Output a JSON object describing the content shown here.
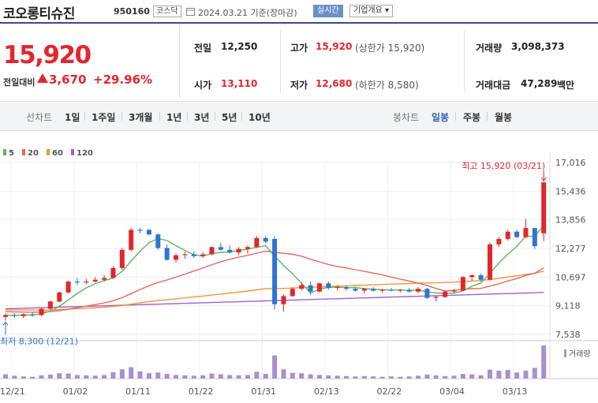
{
  "header": {
    "name": "코오롱티슈진",
    "code": "950160",
    "market": "코스닥",
    "asof": "2024.03.21  기준(장마감)",
    "realtime_label": "실시간",
    "overview_label": "기업개요 ▾"
  },
  "price": {
    "current": "15,920",
    "change_label": "전일대비",
    "change": "3,670",
    "change_pct": "+29.96%"
  },
  "stats": {
    "prev_close_label": "전일",
    "prev_close": "12,250",
    "open_label": "시가",
    "open": "13,110",
    "high_label": "고가",
    "high": "15,920",
    "high_note": "(상한가 15,920)",
    "low_label": "저가",
    "low": "12,680",
    "low_note": "(하한가 8,580)",
    "volume_label": "거래량",
    "volume": "3,098,373",
    "amount_label": "거래대금",
    "amount": "47,289",
    "amount_unit": "백만"
  },
  "period_bar": {
    "line_label": "선차트",
    "line_periods": [
      "1일",
      "1주일",
      "3개월",
      "1년",
      "3년",
      "5년",
      "10년"
    ],
    "candle_label": "봉차트",
    "candle_periods": [
      "일봉",
      "주봉",
      "월봉"
    ],
    "active_candle": "일봉"
  },
  "colors": {
    "up": "#e3262d",
    "down": "#2f74d0",
    "ma5": "#5cb85c",
    "ma20": "#e8685f",
    "ma60": "#f0963a",
    "ma120": "#a064cc"
  },
  "chart_data": {
    "type": "candlestick",
    "legend": [
      {
        "name": "5",
        "color": "#5cb85c"
      },
      {
        "name": "20",
        "color": "#e8685f"
      },
      {
        "name": "60",
        "color": "#f0963a"
      },
      {
        "name": "120",
        "color": "#a064cc"
      }
    ],
    "y_ticks": [
      "17,016",
      "15,436",
      "13,856",
      "12,277",
      "10,697",
      "9,118",
      "7,538"
    ],
    "ylim": [
      7538,
      17016
    ],
    "x_tick_labels": [
      "12/21",
      "01/02",
      "01/11",
      "01/22",
      "01/31",
      "02/13",
      "02/22",
      "03/04",
      "03/13"
    ],
    "x_tick_index": [
      0,
      7,
      14,
      21,
      28,
      35,
      42,
      49,
      56
    ],
    "max_annotation": "최고 15,920 (03/21)",
    "min_annotation": "최저 8,300 (12/21)",
    "volume_label": "거래량",
    "candles": [
      {
        "o": 8500,
        "h": 8700,
        "l": 8300,
        "c": 8600
      },
      {
        "o": 8600,
        "h": 8700,
        "l": 8450,
        "c": 8550
      },
      {
        "o": 8550,
        "h": 8700,
        "l": 8450,
        "c": 8650
      },
      {
        "o": 8650,
        "h": 8750,
        "l": 8500,
        "c": 8600
      },
      {
        "o": 8600,
        "h": 9000,
        "l": 8550,
        "c": 8950
      },
      {
        "o": 8950,
        "h": 9400,
        "l": 8900,
        "c": 9350
      },
      {
        "o": 9350,
        "h": 9900,
        "l": 9300,
        "c": 9850
      },
      {
        "o": 9850,
        "h": 10500,
        "l": 9800,
        "c": 10450
      },
      {
        "o": 10450,
        "h": 10650,
        "l": 10250,
        "c": 10400
      },
      {
        "o": 10400,
        "h": 10600,
        "l": 10300,
        "c": 10450
      },
      {
        "o": 10450,
        "h": 10700,
        "l": 10400,
        "c": 10550
      },
      {
        "o": 10550,
        "h": 10800,
        "l": 10450,
        "c": 10650
      },
      {
        "o": 10650,
        "h": 11300,
        "l": 10600,
        "c": 11200
      },
      {
        "o": 11200,
        "h": 12300,
        "l": 11100,
        "c": 12200
      },
      {
        "o": 12200,
        "h": 13400,
        "l": 12100,
        "c": 13300
      },
      {
        "o": 13300,
        "h": 13400,
        "l": 13100,
        "c": 13250
      },
      {
        "o": 13300,
        "h": 13350,
        "l": 13000,
        "c": 13050
      },
      {
        "o": 13050,
        "h": 13100,
        "l": 12200,
        "c": 12300
      },
      {
        "o": 12300,
        "h": 12500,
        "l": 11600,
        "c": 11650
      },
      {
        "o": 11650,
        "h": 12000,
        "l": 11500,
        "c": 11900
      },
      {
        "o": 11900,
        "h": 12100,
        "l": 11700,
        "c": 11950
      },
      {
        "o": 11950,
        "h": 12100,
        "l": 11750,
        "c": 11850
      },
      {
        "o": 11850,
        "h": 12050,
        "l": 11750,
        "c": 11950
      },
      {
        "o": 11950,
        "h": 12400,
        "l": 11900,
        "c": 12350
      },
      {
        "o": 12350,
        "h": 12600,
        "l": 12150,
        "c": 12200
      },
      {
        "o": 12200,
        "h": 12450,
        "l": 12000,
        "c": 12050
      },
      {
        "o": 12050,
        "h": 12350,
        "l": 11900,
        "c": 12250
      },
      {
        "o": 12250,
        "h": 12450,
        "l": 12000,
        "c": 12350
      },
      {
        "o": 12350,
        "h": 12950,
        "l": 12300,
        "c": 12850
      },
      {
        "o": 12850,
        "h": 12950,
        "l": 12550,
        "c": 12650
      },
      {
        "o": 12800,
        "h": 12950,
        "l": 8900,
        "c": 9200
      },
      {
        "o": 9200,
        "h": 9750,
        "l": 8800,
        "c": 9650
      },
      {
        "o": 9650,
        "h": 10150,
        "l": 9600,
        "c": 10050
      },
      {
        "o": 10050,
        "h": 10400,
        "l": 9950,
        "c": 10250
      },
      {
        "o": 10250,
        "h": 10450,
        "l": 9700,
        "c": 9900
      },
      {
        "o": 9900,
        "h": 10400,
        "l": 9850,
        "c": 10350
      },
      {
        "o": 10350,
        "h": 10450,
        "l": 10000,
        "c": 10100
      },
      {
        "o": 10100,
        "h": 10250,
        "l": 9950,
        "c": 10150
      },
      {
        "o": 10150,
        "h": 10250,
        "l": 9950,
        "c": 10050
      },
      {
        "o": 10050,
        "h": 10150,
        "l": 9900,
        "c": 9950
      },
      {
        "o": 9950,
        "h": 10100,
        "l": 9800,
        "c": 10050
      },
      {
        "o": 10050,
        "h": 10150,
        "l": 9900,
        "c": 9950
      },
      {
        "o": 9950,
        "h": 10050,
        "l": 9850,
        "c": 10000
      },
      {
        "o": 10000,
        "h": 10100,
        "l": 9900,
        "c": 9950
      },
      {
        "o": 9950,
        "h": 10050,
        "l": 9850,
        "c": 10000
      },
      {
        "o": 10000,
        "h": 10100,
        "l": 9850,
        "c": 9900
      },
      {
        "o": 9900,
        "h": 10150,
        "l": 9800,
        "c": 10050
      },
      {
        "o": 10050,
        "h": 10100,
        "l": 9500,
        "c": 9550
      },
      {
        "o": 9550,
        "h": 9650,
        "l": 9350,
        "c": 9600
      },
      {
        "o": 9600,
        "h": 9950,
        "l": 9550,
        "c": 9900
      },
      {
        "o": 9900,
        "h": 10050,
        "l": 9800,
        "c": 9950
      },
      {
        "o": 9950,
        "h": 10750,
        "l": 9900,
        "c": 10700
      },
      {
        "o": 10700,
        "h": 10850,
        "l": 10500,
        "c": 10800
      },
      {
        "o": 10800,
        "h": 10900,
        "l": 10450,
        "c": 10550
      },
      {
        "o": 10550,
        "h": 12600,
        "l": 10500,
        "c": 12500
      },
      {
        "o": 12500,
        "h": 12900,
        "l": 12350,
        "c": 12800
      },
      {
        "o": 12800,
        "h": 13300,
        "l": 12700,
        "c": 13200
      },
      {
        "o": 13200,
        "h": 13300,
        "l": 12850,
        "c": 12900
      },
      {
        "o": 12900,
        "h": 13900,
        "l": 12850,
        "c": 13400
      },
      {
        "o": 13400,
        "h": 13400,
        "l": 12250,
        "c": 12400
      },
      {
        "o": 13110,
        "h": 15920,
        "l": 12680,
        "c": 15920
      }
    ],
    "volume": [
      1.2,
      0.8,
      0.6,
      0.5,
      0.9,
      1.1,
      1.5,
      1.4,
      1.0,
      0.9,
      0.8,
      1.0,
      1.8,
      2.6,
      3.2,
      2.0,
      1.5,
      1.7,
      1.3,
      1.0,
      0.9,
      0.8,
      0.9,
      1.4,
      1.2,
      1.0,
      0.9,
      1.0,
      1.9,
      1.3,
      6.5,
      2.6,
      1.6,
      1.5,
      1.2,
      1.0,
      0.9,
      0.8,
      0.7,
      0.6,
      0.7,
      0.6,
      0.5,
      0.6,
      0.5,
      0.6,
      0.8,
      1.1,
      0.9,
      0.7,
      0.8,
      1.3,
      1.2,
      0.9,
      2.5,
      2.2,
      2.4,
      1.7,
      2.2,
      3.0,
      9.3
    ]
  }
}
